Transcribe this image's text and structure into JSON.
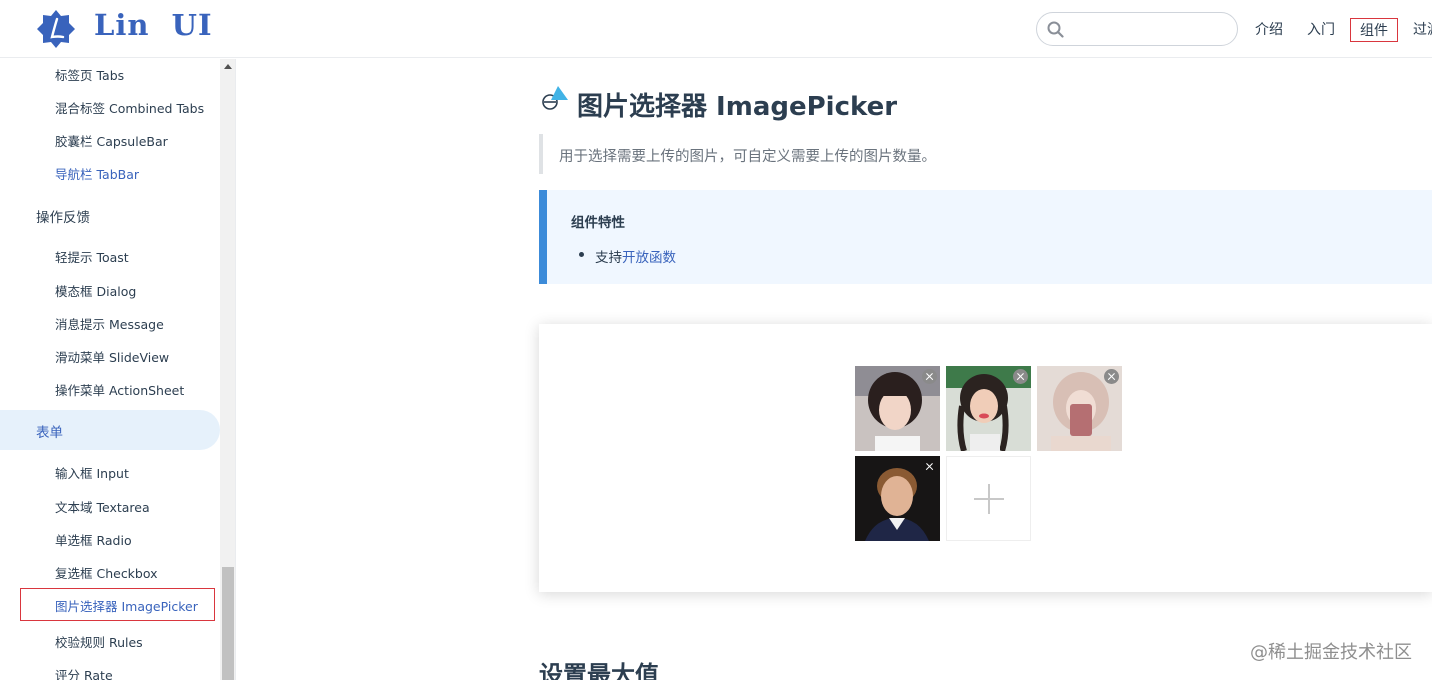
{
  "header": {
    "brand": "Lin  UI",
    "search": {
      "value": "",
      "placeholder": ""
    },
    "nav": [
      {
        "label": "介绍"
      },
      {
        "label": "入门"
      },
      {
        "label": "组件"
      },
      {
        "label": "过滤"
      }
    ]
  },
  "sidebar": {
    "items_top": [
      {
        "label": "标签页 Tabs"
      },
      {
        "label": "混合标签 Combined Tabs"
      },
      {
        "label": "胶囊栏 CapsuleBar"
      },
      {
        "label": "导航栏 TabBar"
      }
    ],
    "group_feedback": "操作反馈",
    "items_feedback": [
      {
        "label": "轻提示 Toast"
      },
      {
        "label": "模态框 Dialog"
      },
      {
        "label": "消息提示 Message"
      },
      {
        "label": "滑动菜单 SlideView"
      },
      {
        "label": "操作菜单 ActionSheet"
      }
    ],
    "group_form": "表单",
    "items_form": [
      {
        "label": "输入框 Input"
      },
      {
        "label": "文本域 Textarea"
      },
      {
        "label": "单选框 Radio"
      },
      {
        "label": "复选框 Checkbox"
      },
      {
        "label": "图片选择器 ImagePicker"
      },
      {
        "label": "校验规则 Rules"
      },
      {
        "label": "评分 Rate"
      }
    ]
  },
  "main": {
    "title": "图片选择器 ImagePicker",
    "description": "用于选择需要上传的图片，可自定义需要上传的图片数量。",
    "features": {
      "title": "组件特性",
      "item_prefix": "支持",
      "item_link": "开放函数"
    },
    "next_heading": "设置最大值"
  },
  "watermark": "@稀土掘金技术社区",
  "colors": {
    "brand": "#3963bc",
    "text": "#2c3e50",
    "active_bg": "#e6f1fb",
    "tip_border": "#3c8bd9",
    "tip_bg": "#f0f7ff",
    "highlight_red": "#d9363e"
  }
}
